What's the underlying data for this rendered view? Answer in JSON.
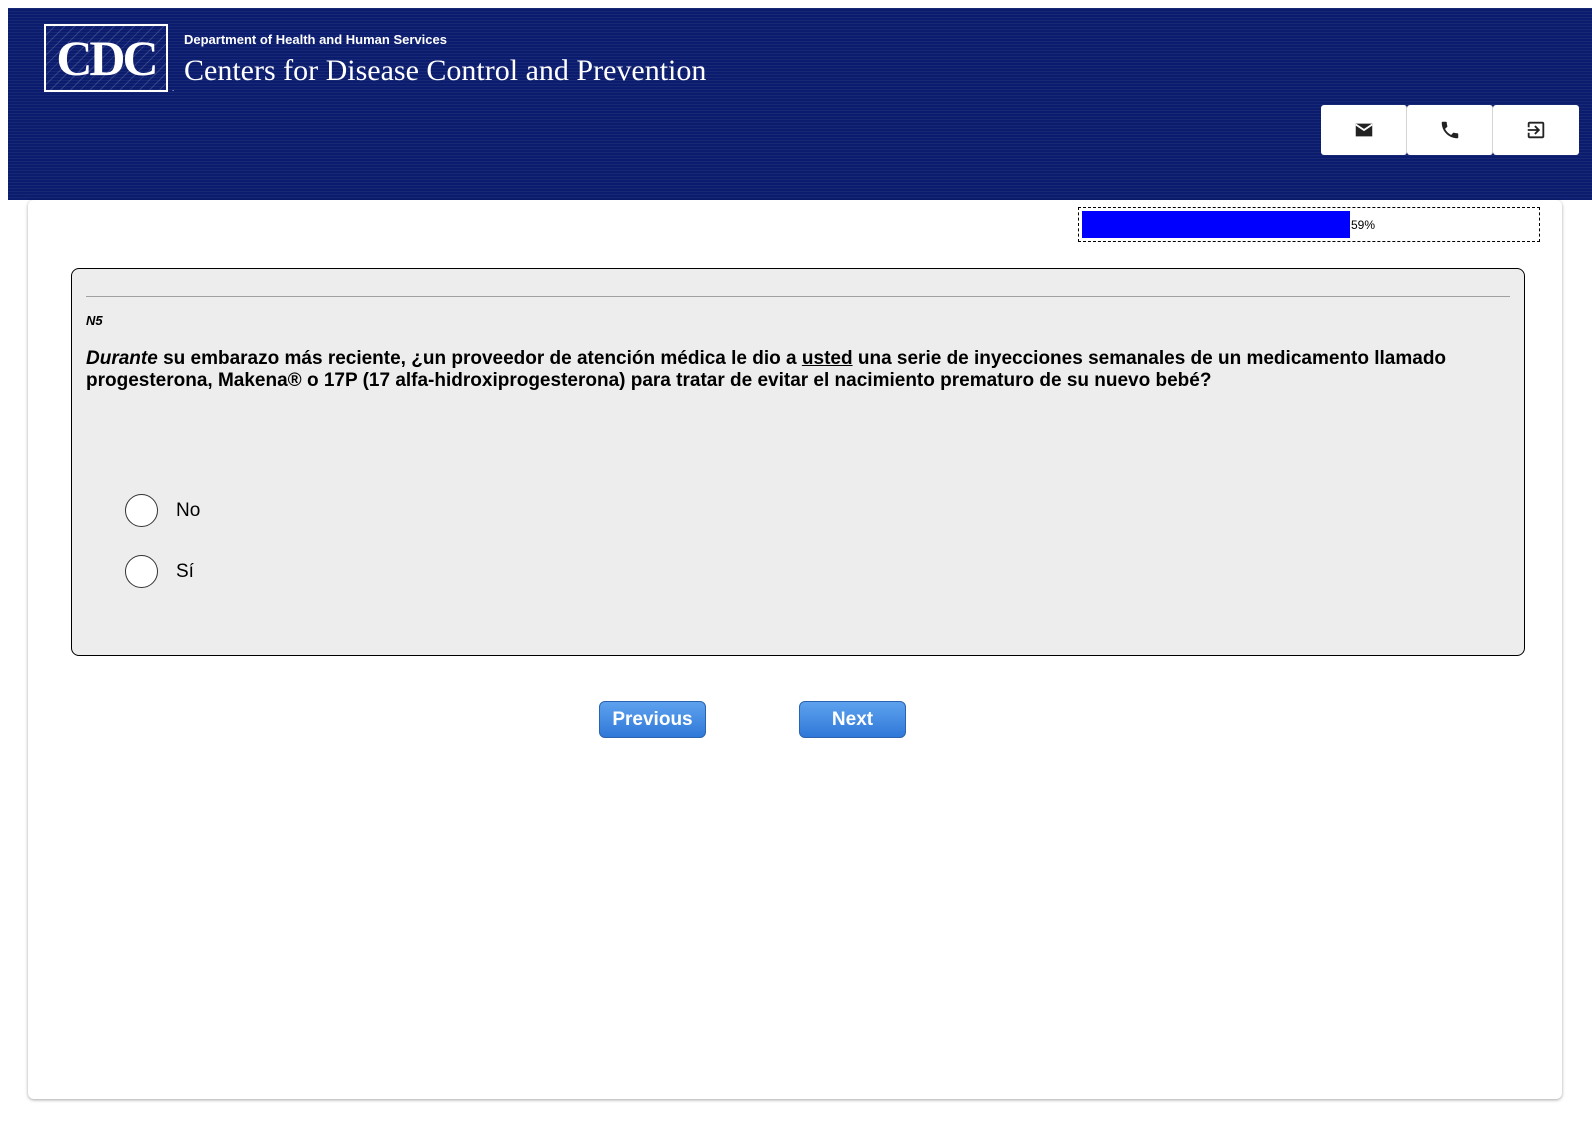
{
  "header": {
    "logo_text": "CDC",
    "department": "Department of Health and Human Services",
    "organization": "Centers for Disease Control and Prevention",
    "icons": [
      "envelope-icon",
      "phone-icon",
      "logout-icon"
    ]
  },
  "progress": {
    "percent": 59,
    "label": "59%"
  },
  "question": {
    "code": "N5",
    "text_part1": "Durante",
    "text_part2": " su embarazo más reciente, ¿un proveedor de atención médica le dio a ",
    "text_part3": "usted",
    "text_part4": " una serie de inyecciones semanales de un medicamento llamado progesterona, Makena® o 17P (17 alfa-hidroxiprogesterona) para tratar de evitar el nacimiento prematuro de su nuevo bebé?",
    "options": [
      {
        "label": "No",
        "selected": false
      },
      {
        "label": "Sí",
        "selected": false
      }
    ]
  },
  "navigation": {
    "previous_label": "Previous",
    "next_label": "Next"
  },
  "colors": {
    "header_bg": "#0b1c6e",
    "progress_fill": "#0000ff",
    "button_blue": "#2f78d8",
    "question_bg": "#ededed"
  }
}
